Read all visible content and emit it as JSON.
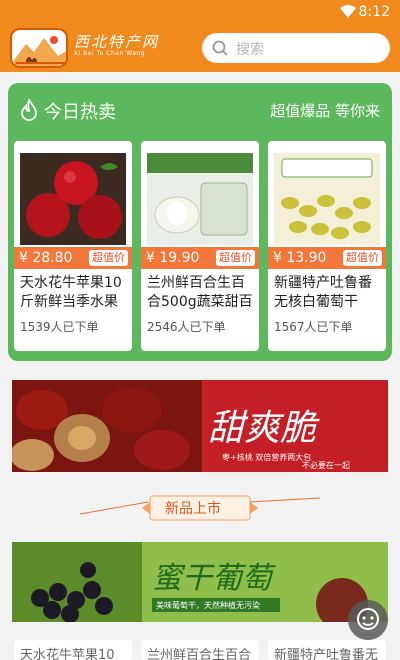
{
  "status_bar": {
    "time": "8:12",
    "wifi_icon": "wifi-icon"
  },
  "header": {
    "brand_cn": "西北特产网",
    "brand_pinyin": "Xi Bei Te Chan Wang",
    "search_placeholder": "搜索"
  },
  "hot_section": {
    "title": "今日热卖",
    "slogan": "超值爆品 等你来",
    "products": [
      {
        "price": "¥ 28.80",
        "tag": "超值价",
        "name": "天水花牛苹果10斤新鲜当季水果",
        "sold": "1539人已下单",
        "image": "red-apples"
      },
      {
        "price": "¥ 19.90",
        "tag": "超值价",
        "name": "兰州鲜百合生百合500g蔬菜甜百合",
        "sold": "2546人已下单",
        "image": "lanzhou-lily"
      },
      {
        "price": "¥ 13.90",
        "tag": "超值价",
        "name": "新疆特产吐鲁番无核白葡萄干",
        "sold": "1567人已下单",
        "image": "green-raisins"
      }
    ]
  },
  "banners": {
    "jujube": {
      "headline": "甜爽脆",
      "sub1": "枣+核桃 双倍营养两大包",
      "sub2": "不必要在一起"
    },
    "raisin": {
      "headline": "蜜干葡萄",
      "sub": "美味葡萄干，天然种植无污染"
    }
  },
  "new_section": {
    "title": "新品上市"
  },
  "bottom_row": [
    "天水花牛苹果10",
    "兰州鲜百合生百合",
    "新疆特产吐鲁番无"
  ],
  "fab_icon": "chat-icon"
}
